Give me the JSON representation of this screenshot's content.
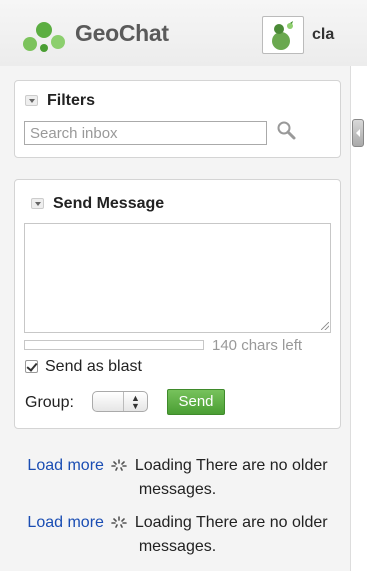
{
  "header": {
    "app_name": "GeoChat",
    "user_name": "cla",
    "logo_icon": "geochat-logo-icon",
    "avatar_icon": "user-avatar-icon"
  },
  "filters": {
    "title": "Filters",
    "search_placeholder": "Search inbox",
    "search_value": ""
  },
  "send_message": {
    "title": "Send Message",
    "message_value": "",
    "chars_left": "140 chars left",
    "blast_label": "Send as blast",
    "blast_checked": true,
    "group_label": "Group:",
    "group_selected": "",
    "send_label": "Send"
  },
  "status_lines": [
    {
      "load_more": "Load more",
      "loading": "Loading",
      "message": "There are no older messages."
    },
    {
      "load_more": "Load more",
      "loading": "Loading",
      "message": "There are no older messages."
    }
  ],
  "colors": {
    "accent_green": "#5cae42",
    "link_blue": "#1a4db3",
    "header_bg": "#f0f0f0"
  }
}
